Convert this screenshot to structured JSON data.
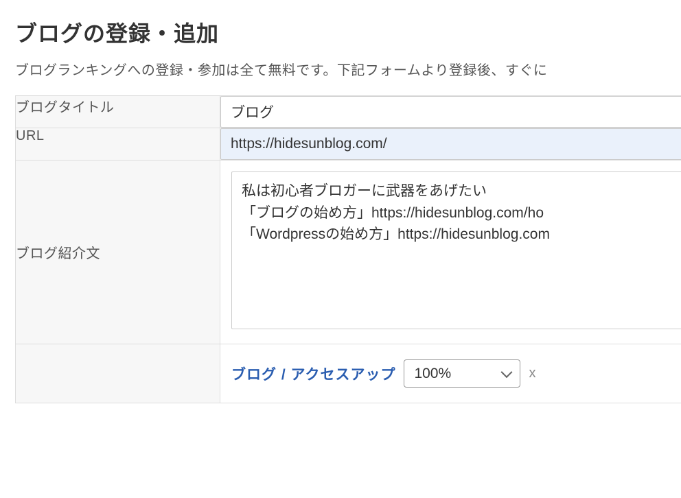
{
  "page": {
    "title": "ブログの登録・追加",
    "description": "ブログランキングへの登録・参加は全て無料です。下記フォームより登録後、すぐに"
  },
  "form": {
    "blog_title": {
      "label": "ブログタイトル",
      "value": "ブログ"
    },
    "url": {
      "label": "URL",
      "value": "https://hidesunblog.com/"
    },
    "intro": {
      "label": "ブログ紹介文",
      "value": "私は初心者ブロガーに武器をあげたい\n「ブログの始め方」https://hidesunblog.com/ho\n「Wordpressの始め方」https://hidesunblog.com"
    },
    "category": {
      "label": "ブログ / アクセスアップ",
      "percent_selected": "100%",
      "remove": "x"
    }
  }
}
